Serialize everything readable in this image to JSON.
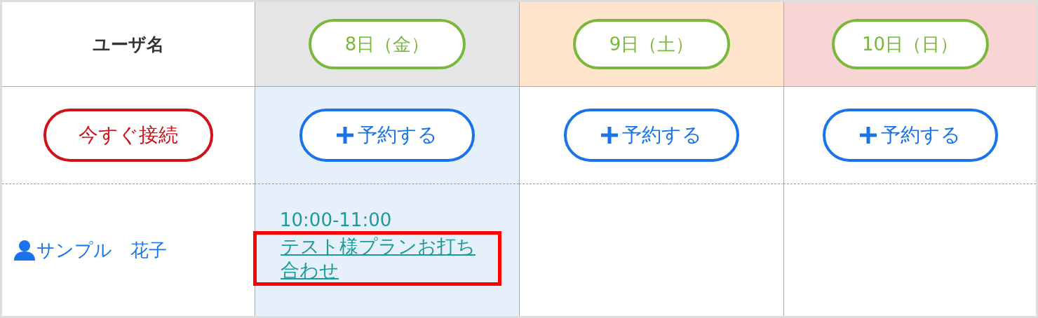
{
  "user_column": {
    "label": "ユーザ名"
  },
  "connect_button": {
    "label": "今すぐ接続"
  },
  "days": [
    {
      "label": "8日（金）",
      "color": "#e5e5e5",
      "selected": true,
      "reserve_label": "予約する",
      "bookings": [
        {
          "time": "10:00-11:00",
          "title": "テスト様プランお打ち合わせ",
          "highlighted": true
        }
      ]
    },
    {
      "label": "9日（土）",
      "color": "#fde4cb",
      "selected": false,
      "reserve_label": "予約する"
    },
    {
      "label": "10日（日）",
      "color": "#f9d4d4",
      "selected": false,
      "reserve_label": "予約する"
    }
  ],
  "users": [
    {
      "name": "サンプル　花子"
    }
  ]
}
